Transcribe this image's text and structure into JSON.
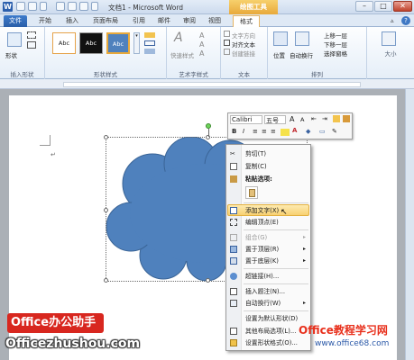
{
  "window": {
    "title": "文档1 - Microsoft Word",
    "context_tool": "绘图工具"
  },
  "tabs": [
    "文件",
    "开始",
    "插入",
    "页面布局",
    "引用",
    "邮件",
    "审阅",
    "视图",
    "格式"
  ],
  "ribbon": {
    "insert_shapes": {
      "label": "插入形状",
      "item": "形状"
    },
    "shape_styles": {
      "label": "形状样式",
      "samples": [
        "Abc",
        "Abc",
        "Abc"
      ]
    },
    "wordart": {
      "label": "艺术字样式",
      "quick": "快速样式",
      "text_fill": "A"
    },
    "text": {
      "label": "文本",
      "items": [
        "文字方向",
        "对齐文本",
        "创建链接"
      ]
    },
    "arrange": {
      "label": "排列",
      "position": "位置",
      "wrap": "自动换行",
      "items": [
        "上移一层",
        "下移一层",
        "选择窗格"
      ]
    },
    "size": {
      "label": "大小"
    }
  },
  "mini_toolbar": {
    "font": "Calibri",
    "size": "五号",
    "grow": "A",
    "shrink": "A",
    "bold": "B",
    "italic": "I"
  },
  "context_menu": {
    "items": [
      {
        "label": "剪切(T)",
        "icon": "scissors-icon",
        "disabled": false
      },
      {
        "label": "复制(C)",
        "icon": "copy-icon",
        "disabled": false
      },
      {
        "label": "粘贴选项:",
        "icon": "paste-icon",
        "disabled": false
      },
      {
        "label": "添加文字(X)",
        "icon": "text-box-icon",
        "disabled": false,
        "highlighted": true
      },
      {
        "label": "编辑顶点(E)",
        "icon": "edit-points-icon",
        "disabled": false
      },
      {
        "label": "组合(G)",
        "icon": "group-icon",
        "disabled": true
      },
      {
        "label": "置于顶层(R)",
        "icon": "bring-front-icon",
        "disabled": false
      },
      {
        "label": "置于底层(K)",
        "icon": "send-back-icon",
        "disabled": false
      },
      {
        "label": "超链接(H)...",
        "icon": "hyperlink-icon",
        "disabled": false
      },
      {
        "label": "插入题注(N)...",
        "icon": "caption-icon",
        "disabled": false
      },
      {
        "label": "自动换行(W)",
        "icon": "wrap-icon",
        "disabled": false
      },
      {
        "label": "设置为默认形状(D)",
        "icon": "",
        "disabled": false
      },
      {
        "label": "其他布局选项(L)...",
        "icon": "layout-icon",
        "disabled": false
      },
      {
        "label": "设置形状格式(O)...",
        "icon": "format-icon",
        "disabled": false
      }
    ]
  },
  "branding": {
    "badge": "Office办公助手",
    "site": "Officezhushou.com",
    "watermark_title": "Office教程学习网",
    "watermark_url": "www.office68.com"
  },
  "colors": {
    "shape_fill": "#4f81bd",
    "shape_outline": "#2f5a8c",
    "context_tab": "#e8a93b",
    "menu_highlight": "#f8d172"
  }
}
